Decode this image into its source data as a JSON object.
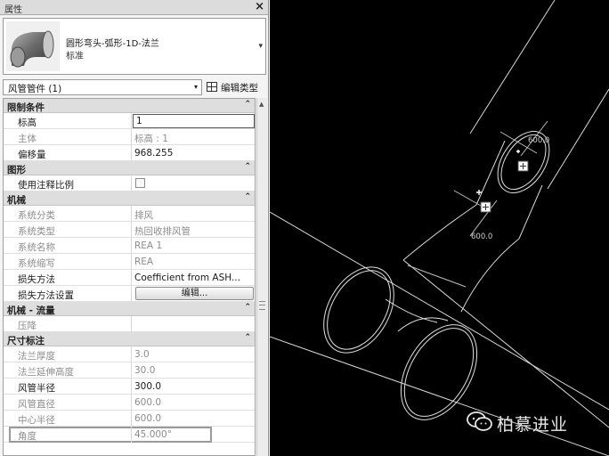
{
  "panel": {
    "title": "属性",
    "close_glyph": "×",
    "type_selector": {
      "family": "圆形弯头-弧形-1D-法兰",
      "type": "标准",
      "dropdown_glyph": "▾"
    },
    "instance_filter": {
      "value": "风管管件 (1)",
      "edit_type_label": "编辑类型"
    },
    "collapse_glyph": "⌃",
    "sections": {
      "constraints": "限制条件",
      "graphics": "图形",
      "mechanical": "机械",
      "mechanical_flow": "机械 - 流量",
      "dimensions": "尺寸标注"
    },
    "properties": {
      "level": {
        "label": "标高",
        "value": "1"
      },
      "host": {
        "label": "主体",
        "value": "标高 : 1"
      },
      "offset": {
        "label": "偏移量",
        "value": "968.255"
      },
      "use_annotation_scale": {
        "label": "使用注释比例",
        "checked": false
      },
      "system_classification": {
        "label": "系统分类",
        "value": "排风"
      },
      "system_type": {
        "label": "系统类型",
        "value": "热回收排风管"
      },
      "system_name": {
        "label": "系统名称",
        "value": "REA 1"
      },
      "system_abbreviation": {
        "label": "系统缩写",
        "value": "REA"
      },
      "loss_method": {
        "label": "损失方法",
        "value": "Coefficient from ASH..."
      },
      "loss_method_settings": {
        "label": "损失方法设置",
        "button": "编辑..."
      },
      "pressure_drop": {
        "label": "压降",
        "value": ""
      },
      "flange_thickness": {
        "label": "法兰厚度",
        "value": "3.0"
      },
      "flange_extension": {
        "label": "法兰延伸高度",
        "value": "30.0"
      },
      "duct_radius": {
        "label": "风管半径",
        "value": "300.0"
      },
      "duct_diameter": {
        "label": "风管直径",
        "value": "600.0"
      },
      "center_radius": {
        "label": "中心半径",
        "value": "600.0"
      },
      "angle": {
        "label": "角度",
        "value": "45.000°"
      }
    }
  },
  "viewport": {
    "dimension_labels": [
      "600.0",
      "600.0"
    ],
    "background": "#000000"
  },
  "watermark": {
    "text": "柏慕进业",
    "icon": "wechat-icon"
  },
  "colors": {
    "panel_bg": "#f4f4f4",
    "section_bg": "#dedede",
    "readonly_text": "#8c8c8c",
    "drawing_lines": "#d8d8d8"
  }
}
